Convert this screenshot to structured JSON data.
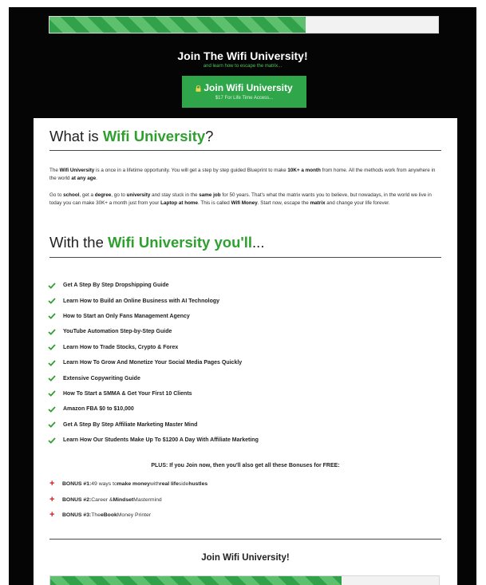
{
  "top_progress": {
    "fill_fraction": 0.66
  },
  "header": {
    "title": "Join The Wifi University!",
    "subtitle": "and learn how to escape the matrix..."
  },
  "cta": {
    "label": "Join Wifi University",
    "sublabel": "$17 For Life Time Access...",
    "icon": "lock-icon"
  },
  "section1": {
    "heading_prefix": "What is ",
    "heading_accent": "Wifi University",
    "heading_suffix": "?"
  },
  "para1": {
    "p1": "The ",
    "b1": "Wifi University",
    "p2": " is a once in a lifetime opportunity. You will get a step by step guided Blueprint to make ",
    "b2": "10K+ a month",
    "p3": " from home. All the methods work from anywhere in the world ",
    "b3": "at any age",
    "p4": "."
  },
  "para2": {
    "p1": "Go to ",
    "b1": "school",
    "p2": ", get a ",
    "b2": "degree",
    "p3": ", go to ",
    "b3": "university",
    "p4": " and stay stuck in the ",
    "b4": "same job",
    "p5": " for 50 years. That's what the matrix wants you to believe, but nowadays, in the world we live in today you can make 30K+ a month just from your ",
    "b5": "Laptop at home",
    "p6": ". This is called ",
    "b6": "Wifi Money",
    "p7": ". Start now, escape the ",
    "b7": "matrix",
    "p8": " and change your life forever."
  },
  "section2": {
    "heading_prefix": "With the ",
    "heading_accent": "Wifi University you'll",
    "heading_suffix": "..."
  },
  "features": [
    "Get A Step By Step Dropshipping Guide",
    "Learn How to Build an Online Business with AI Technology",
    "How to Start an Only Fans Management Agency",
    "YouTube Automation Step-by-Step Guide",
    "Learn How to Trade Stocks, Crypto & Forex",
    "Learn How To Grow And Monetize Your Social Media Pages Quickly",
    "Extensive Copywriting Guide",
    "How To Start a SMMA & Get Your First 10 Clients",
    "Amazon FBA $0 to $10,000",
    "Get A Step By Step Affiliate Marketing Master Mind",
    "Learn How Our Students Make Up To $1200 A Day With Affiliate Marketing"
  ],
  "plus_note": "PLUS: If you Join now, then you'll also get all these Bonuses for FREE:",
  "bonuses": [
    {
      "label": "BONUS #1:",
      "t1": " 49 ways to ",
      "b1": "make money",
      "t2": " with ",
      "b2": "real life",
      "t3": " side ",
      "b3": "hustles",
      "t4": ""
    },
    {
      "label": "BONUS #2:",
      "t1": " Career & ",
      "b1": "Mindset",
      "t2": " Mastermind",
      "b2": "",
      "t3": "",
      "b3": "",
      "t4": ""
    },
    {
      "label": "BONUS #3:",
      "t1": " The ",
      "b1": "eBook",
      "t2": " Money Printer",
      "b2": "",
      "t3": "",
      "b3": "",
      "t4": ""
    }
  ],
  "footer": {
    "title": "Join Wifi University!",
    "progress_fill_fraction": 0.75
  },
  "colors": {
    "accent_green": "#2fa02f",
    "button_green": "#2fa64a",
    "bonus_red": "#d21b1b",
    "background": "#050505"
  }
}
